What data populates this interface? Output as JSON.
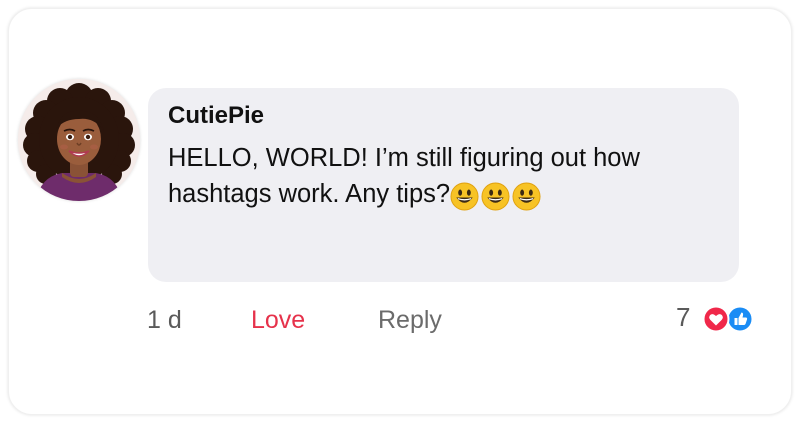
{
  "comment": {
    "author": "CutiePie",
    "text": "HELLO, WORLD! I’m still figuring out how hashtags work. Any tips?",
    "emojis": [
      "grinning-face-emoji",
      "grinning-face-emoji",
      "grinning-face-emoji"
    ]
  },
  "actions": {
    "timestamp": "1 d",
    "love_label": "Love",
    "reply_label": "Reply"
  },
  "reactions": {
    "count": "7",
    "icons": [
      "heart-reaction-icon",
      "like-reaction-icon"
    ]
  },
  "colors": {
    "bubble": "#efeff3",
    "love": "#e6324b",
    "heart_badge": "#f0284a",
    "like_badge": "#1a8cf5",
    "meta_text": "#6b6b6b"
  }
}
